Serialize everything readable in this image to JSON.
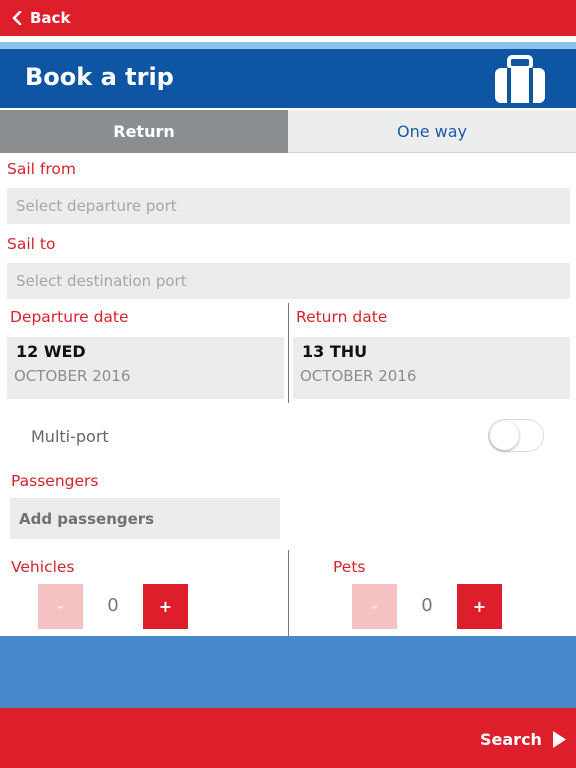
{
  "topbar": {
    "back_label": "Back"
  },
  "header": {
    "title": "Book a trip",
    "icon": "luggage-icon"
  },
  "tabs": [
    {
      "label": "Return",
      "selected": true
    },
    {
      "label": "One way",
      "selected": false
    }
  ],
  "sail_from": {
    "label": "Sail from",
    "placeholder": "Select departure port"
  },
  "sail_to": {
    "label": "Sail to",
    "placeholder": "Select destination port"
  },
  "departure": {
    "label": "Departure date",
    "day": "12 WED",
    "month": "OCTOBER 2016"
  },
  "return_date": {
    "label": "Return date",
    "day": "13 THU",
    "month": "OCTOBER 2016"
  },
  "multiport": {
    "label": "Multi-port",
    "enabled": false
  },
  "passengers": {
    "label": "Passengers",
    "button": "Add passengers"
  },
  "vehicles": {
    "label": "Vehicles",
    "minus": "-",
    "value": "0",
    "plus": "+"
  },
  "pets": {
    "label": "Pets",
    "minus": "-",
    "value": "0",
    "plus": "+"
  },
  "footer": {
    "search_label": "Search"
  },
  "colors": {
    "red": "#dc1f2b",
    "blue": "#0e56a4",
    "light_blue": "#89c0ec",
    "band_blue": "#4589cb",
    "grey_tab": "#8b8e90"
  }
}
